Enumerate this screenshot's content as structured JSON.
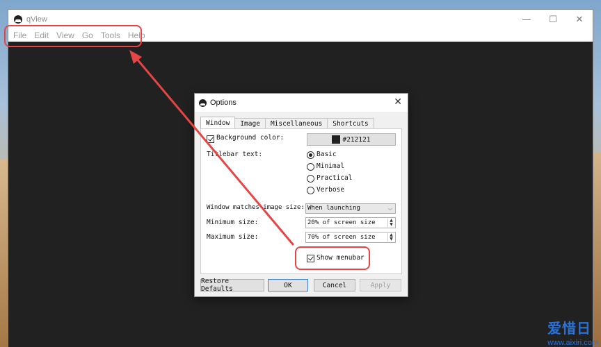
{
  "app": {
    "title": "qView",
    "controls": {
      "minimize": "—",
      "maximize": "☐",
      "close": "✕"
    }
  },
  "menubar": {
    "items": [
      "File",
      "Edit",
      "View",
      "Go",
      "Tools",
      "Help"
    ]
  },
  "dialog": {
    "title": "Options",
    "close": "✕",
    "tabs": [
      "Window",
      "Image",
      "Miscellaneous",
      "Shortcuts"
    ],
    "active_tab": "Window",
    "background_color": {
      "label": "Background color:",
      "checked": true,
      "value": "#212121"
    },
    "titlebar_text": {
      "label": "Titlebar text:",
      "options": [
        "Basic",
        "Minimal",
        "Practical",
        "Verbose"
      ],
      "selected": "Basic"
    },
    "window_matches": {
      "label": "Window matches image size:",
      "value": "When launching"
    },
    "minimum_size": {
      "label": "Minimum size:",
      "value": "20% of screen size"
    },
    "maximum_size": {
      "label": "Maximum size:",
      "value": "70% of screen size"
    },
    "show_menubar": {
      "label": "Show menubar",
      "checked": true
    },
    "buttons": {
      "restore": "Restore Defaults",
      "ok": "OK",
      "cancel": "Cancel",
      "apply": "Apply"
    }
  },
  "annotation": {
    "color": "#e64545"
  },
  "watermark": {
    "text": "爱惜日",
    "url": "www.aixiri.com"
  }
}
